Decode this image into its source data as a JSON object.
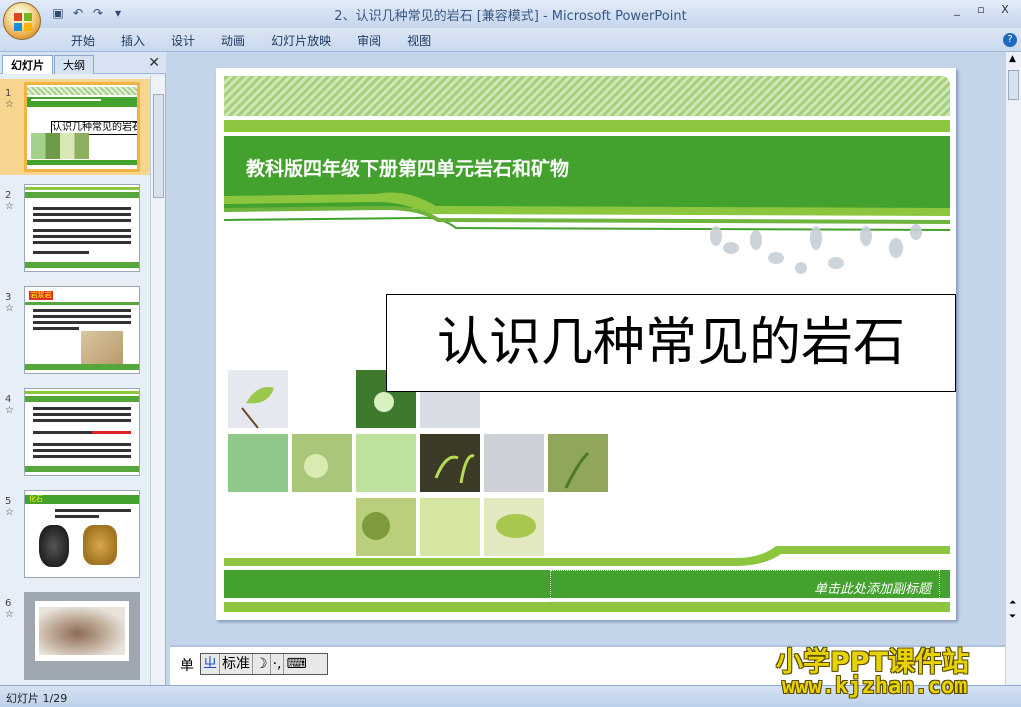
{
  "window": {
    "title": "2、认识几种常见的岩石 [兼容模式] - Microsoft PowerPoint",
    "buttons": [
      "_",
      "▫",
      "X"
    ]
  },
  "ribbon": {
    "tabs": [
      "开始",
      "插入",
      "设计",
      "动画",
      "幻灯片放映",
      "审阅",
      "视图"
    ],
    "help": "?"
  },
  "pane": {
    "tab_slides": "幻灯片",
    "tab_outline": "大纲",
    "close": "✕"
  },
  "thumbnails": [
    {
      "num": "1",
      "mark": "☆",
      "title": "认识几种常见的岩石"
    },
    {
      "num": "2",
      "mark": "☆"
    },
    {
      "num": "3",
      "mark": "☆",
      "heading": "岩浆岩"
    },
    {
      "num": "4",
      "mark": "☆"
    },
    {
      "num": "5",
      "mark": "☆",
      "heading": "化石"
    },
    {
      "num": "6",
      "mark": "☆"
    }
  ],
  "slide": {
    "banner": "教科版四年级下册第四单元岩石和矿物",
    "title": "认识几种常见的岩石",
    "subtitle_placeholder": "单击此处添加副标题"
  },
  "notes": {
    "text": "单"
  },
  "ime": {
    "mode": "标准"
  },
  "status": {
    "slide_counter": "幻灯片 1/29"
  },
  "watermark": {
    "line1": "小学PPT课件站",
    "line2": "www.kjzhan.com"
  },
  "colors": {
    "slide_green": "#43a12e",
    "light_green": "#8cc63e",
    "ribbon_bg": "#c9d9ee",
    "selected_thumb": "#f0b344"
  }
}
